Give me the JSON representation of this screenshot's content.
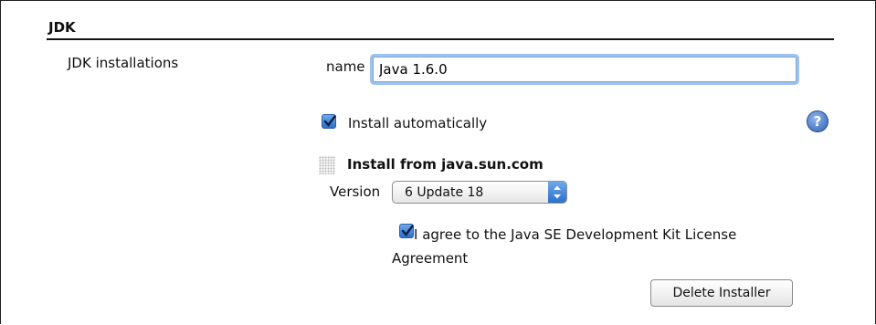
{
  "section": {
    "title": "JDK"
  },
  "jdk_installations": {
    "label": "JDK installations",
    "name_label": "name",
    "name_value": "Java 1.6.0",
    "install_automatically": {
      "label": "Install automatically",
      "checked": true
    },
    "help_icon": "help-icon",
    "installer": {
      "title": "Install from java.sun.com",
      "version_label": "Version",
      "version_selected": "6 Update 18",
      "license": {
        "label": "I agree to the Java SE Development Kit License Agreement",
        "checked": true
      },
      "delete_label": "Delete Installer"
    }
  },
  "colors": {
    "accent": "#2c6fcc",
    "focus_ring": "#9cc3ee"
  }
}
